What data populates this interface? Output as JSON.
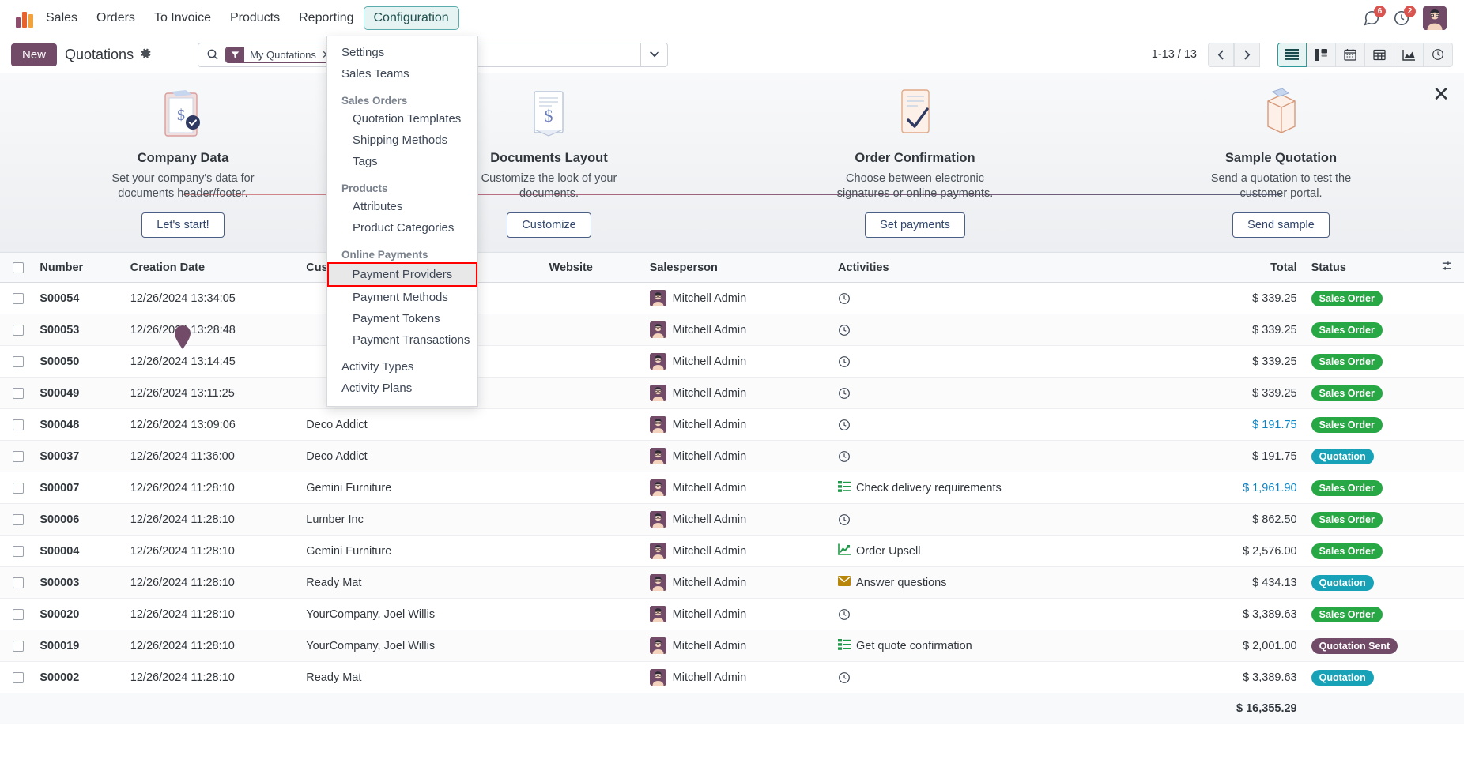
{
  "navbar": {
    "app_name": "Sales",
    "menus": [
      {
        "label": "Orders",
        "active": false
      },
      {
        "label": "To Invoice",
        "active": false
      },
      {
        "label": "Products",
        "active": false
      },
      {
        "label": "Reporting",
        "active": false
      },
      {
        "label": "Configuration",
        "active": true
      }
    ],
    "messages_count": "6",
    "activities_count": "2"
  },
  "dropdown": {
    "items": [
      {
        "label": "Settings",
        "type": "item"
      },
      {
        "label": "Sales Teams",
        "type": "item"
      },
      {
        "label": "Sales Orders",
        "type": "section"
      },
      {
        "label": "Quotation Templates",
        "type": "sub"
      },
      {
        "label": "Shipping Methods",
        "type": "sub"
      },
      {
        "label": "Tags",
        "type": "sub"
      },
      {
        "label": "Products",
        "type": "section"
      },
      {
        "label": "Attributes",
        "type": "sub"
      },
      {
        "label": "Product Categories",
        "type": "sub"
      },
      {
        "label": "Online Payments",
        "type": "section"
      },
      {
        "label": "Payment Providers",
        "type": "sub",
        "highlighted": true
      },
      {
        "label": "Payment Methods",
        "type": "sub"
      },
      {
        "label": "Payment Tokens",
        "type": "sub"
      },
      {
        "label": "Payment Transactions",
        "type": "sub"
      },
      {
        "label": "Activity Types",
        "type": "item"
      },
      {
        "label": "Activity Plans",
        "type": "item"
      }
    ],
    "highlight_color": "#ff0000"
  },
  "controlpanel": {
    "new_label": "New",
    "breadcrumb": "Quotations",
    "pager": "1-13 / 13"
  },
  "search": {
    "facet_label": "My Quotations",
    "placeholder": "Search...",
    "value": ""
  },
  "views": [
    {
      "name": "list-view",
      "icon": "list-icon",
      "active": true
    },
    {
      "name": "kanban-view",
      "icon": "kanban-icon",
      "active": false
    },
    {
      "name": "calendar-view",
      "icon": "calendar-icon",
      "active": false
    },
    {
      "name": "pivot-view",
      "icon": "pivot-icon",
      "active": false
    },
    {
      "name": "graph-view",
      "icon": "graph-icon",
      "active": false
    },
    {
      "name": "activity-view",
      "icon": "clock-icon",
      "active": false
    }
  ],
  "onboarding": {
    "steps": [
      {
        "title": "Company Data",
        "desc": "Set your company's data for documents header/footer.",
        "button": "Let's start!",
        "icon": "clipboard-dollar-icon"
      },
      {
        "title": "Documents Layout",
        "desc": "Customize the look of your documents.",
        "button": "Customize",
        "icon": "document-dollar-icon"
      },
      {
        "title": "Order Confirmation",
        "desc": "Choose between electronic signatures or online payments.",
        "button": "Set payments",
        "icon": "signed-doc-icon"
      },
      {
        "title": "Sample Quotation",
        "desc": "Send a quotation to test the customer portal.",
        "button": "Send sample",
        "icon": "open-box-icon"
      }
    ]
  },
  "table": {
    "columns": [
      "Number",
      "Creation Date",
      "Customer",
      "Website",
      "Salesperson",
      "Activities",
      "Total",
      "Status"
    ],
    "rows": [
      {
        "number": "S00054",
        "date": "12/26/2024 13:34:05",
        "customer": "",
        "website": "",
        "salesperson": "Mitchell Admin",
        "activity": "",
        "activity_icon": "clock-icon",
        "total": "$ 339.25",
        "total_link": false,
        "status": "Sales Order",
        "status_class": "sales-order"
      },
      {
        "number": "S00053",
        "date": "12/26/2024 13:28:48",
        "customer": "",
        "website": "",
        "salesperson": "Mitchell Admin",
        "activity": "",
        "activity_icon": "clock-icon",
        "total": "$ 339.25",
        "total_link": false,
        "status": "Sales Order",
        "status_class": "sales-order"
      },
      {
        "number": "S00050",
        "date": "12/26/2024 13:14:45",
        "customer": "",
        "website": "",
        "salesperson": "Mitchell Admin",
        "activity": "",
        "activity_icon": "clock-icon",
        "total": "$ 339.25",
        "total_link": false,
        "status": "Sales Order",
        "status_class": "sales-order"
      },
      {
        "number": "S00049",
        "date": "12/26/2024 13:11:25",
        "customer": "",
        "website": "",
        "salesperson": "Mitchell Admin",
        "activity": "",
        "activity_icon": "clock-icon",
        "total": "$ 339.25",
        "total_link": false,
        "status": "Sales Order",
        "status_class": "sales-order"
      },
      {
        "number": "S00048",
        "date": "12/26/2024 13:09:06",
        "customer": "Deco Addict",
        "website": "",
        "salesperson": "Mitchell Admin",
        "activity": "",
        "activity_icon": "clock-icon",
        "total": "$ 191.75",
        "total_link": true,
        "status": "Sales Order",
        "status_class": "sales-order"
      },
      {
        "number": "S00037",
        "date": "12/26/2024 11:36:00",
        "customer": "Deco Addict",
        "website": "",
        "salesperson": "Mitchell Admin",
        "activity": "",
        "activity_icon": "clock-icon",
        "total": "$ 191.75",
        "total_link": false,
        "status": "Quotation",
        "status_class": "quotation"
      },
      {
        "number": "S00007",
        "date": "12/26/2024 11:28:10",
        "customer": "Gemini Furniture",
        "website": "",
        "salesperson": "Mitchell Admin",
        "activity": "Check delivery requirements",
        "activity_icon": "todo-list-icon",
        "total": "$ 1,961.90",
        "total_link": true,
        "status": "Sales Order",
        "status_class": "sales-order"
      },
      {
        "number": "S00006",
        "date": "12/26/2024 11:28:10",
        "customer": "Lumber Inc",
        "website": "",
        "salesperson": "Mitchell Admin",
        "activity": "",
        "activity_icon": "clock-icon",
        "total": "$ 862.50",
        "total_link": false,
        "status": "Sales Order",
        "status_class": "sales-order"
      },
      {
        "number": "S00004",
        "date": "12/26/2024 11:28:10",
        "customer": "Gemini Furniture",
        "website": "",
        "salesperson": "Mitchell Admin",
        "activity": "Order Upsell",
        "activity_icon": "chart-up-icon",
        "total": "$ 2,576.00",
        "total_link": false,
        "status": "Sales Order",
        "status_class": "sales-order"
      },
      {
        "number": "S00003",
        "date": "12/26/2024 11:28:10",
        "customer": "Ready Mat",
        "website": "",
        "salesperson": "Mitchell Admin",
        "activity": "Answer questions",
        "activity_icon": "envelope-icon",
        "total": "$ 434.13",
        "total_link": false,
        "status": "Quotation",
        "status_class": "quotation"
      },
      {
        "number": "S00020",
        "date": "12/26/2024 11:28:10",
        "customer": "YourCompany, Joel Willis",
        "website": "",
        "salesperson": "Mitchell Admin",
        "activity": "",
        "activity_icon": "clock-icon",
        "total": "$ 3,389.63",
        "total_link": false,
        "status": "Sales Order",
        "status_class": "sales-order"
      },
      {
        "number": "S00019",
        "date": "12/26/2024 11:28:10",
        "customer": "YourCompany, Joel Willis",
        "website": "",
        "salesperson": "Mitchell Admin",
        "activity": "Get quote confirmation",
        "activity_icon": "todo-list-icon",
        "total": "$ 2,001.00",
        "total_link": false,
        "status": "Quotation Sent",
        "status_class": "quotation-sent"
      },
      {
        "number": "S00002",
        "date": "12/26/2024 11:28:10",
        "customer": "Ready Mat",
        "website": "",
        "salesperson": "Mitchell Admin",
        "activity": "",
        "activity_icon": "clock-icon",
        "total": "$ 3,389.63",
        "total_link": false,
        "status": "Quotation",
        "status_class": "quotation"
      }
    ],
    "footer_total": "$ 16,355.29"
  },
  "colors": {
    "brand": "#714b67",
    "accent": "#017e84",
    "success": "#28a745",
    "info": "#17a2b8",
    "link": "#0d84c4"
  }
}
